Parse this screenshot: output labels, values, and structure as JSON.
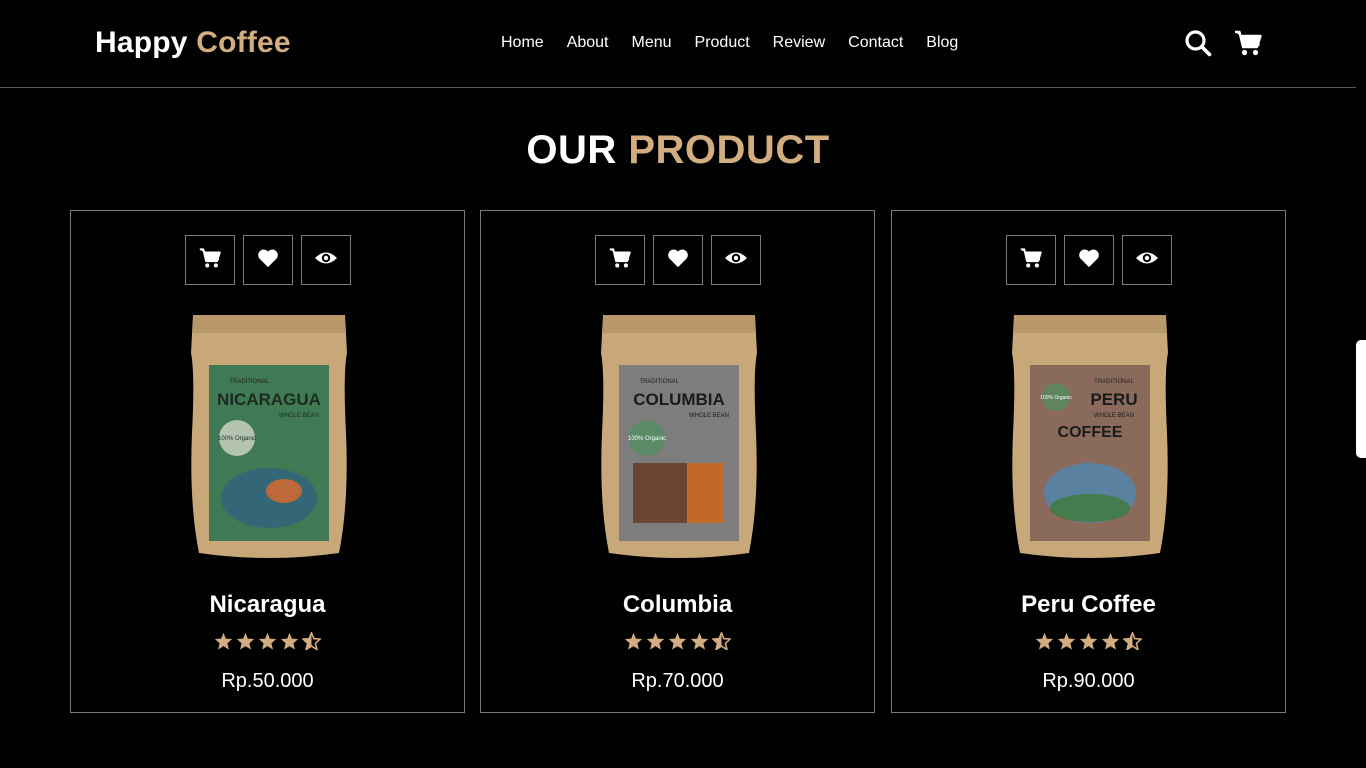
{
  "brand": {
    "word1": "Happy",
    "word2": "Coffee",
    "accent": "#d3ad7f"
  },
  "nav": [
    {
      "label": "Home"
    },
    {
      "label": "About"
    },
    {
      "label": "Menu"
    },
    {
      "label": "Product"
    },
    {
      "label": "Review"
    },
    {
      "label": "Contact"
    },
    {
      "label": "Blog"
    }
  ],
  "header_icons": [
    "search-icon",
    "cart-icon"
  ],
  "section": {
    "title_word1": "OUR",
    "title_word2": "PRODUCT"
  },
  "card_actions": [
    "add-to-cart-icon",
    "heart-icon",
    "eye-icon"
  ],
  "products": [
    {
      "name": "Nicaragua",
      "price": "Rp.50.000",
      "rating": 4.5,
      "bag_label": "NICARAGUA",
      "bag_sub": "WHOLE BEAN",
      "bag_top": "TRADITIONAL",
      "bag_badge": "100% Organic",
      "bag_color": "#3f7a55"
    },
    {
      "name": "Columbia",
      "price": "Rp.70.000",
      "rating": 4.5,
      "bag_label": "COLUMBIA",
      "bag_sub": "WHOLE BEAN",
      "bag_top": "TRADITIONAL",
      "bag_badge": "100% Organic",
      "bag_color": "#7d7d7d"
    },
    {
      "name": "Peru Coffee",
      "price": "Rp.90.000",
      "rating": 4.5,
      "bag_label": "PERU",
      "bag_sub": "WHOLE BEAN",
      "bag_top": "TRADITIONAL",
      "bag_badge": "100% Organic",
      "bag_color": "#8a6a5a",
      "bag_extra": "COFFEE"
    }
  ],
  "colors": {
    "background": "#010101",
    "star": "#d3ad7f",
    "border": "#7a7a7a"
  }
}
